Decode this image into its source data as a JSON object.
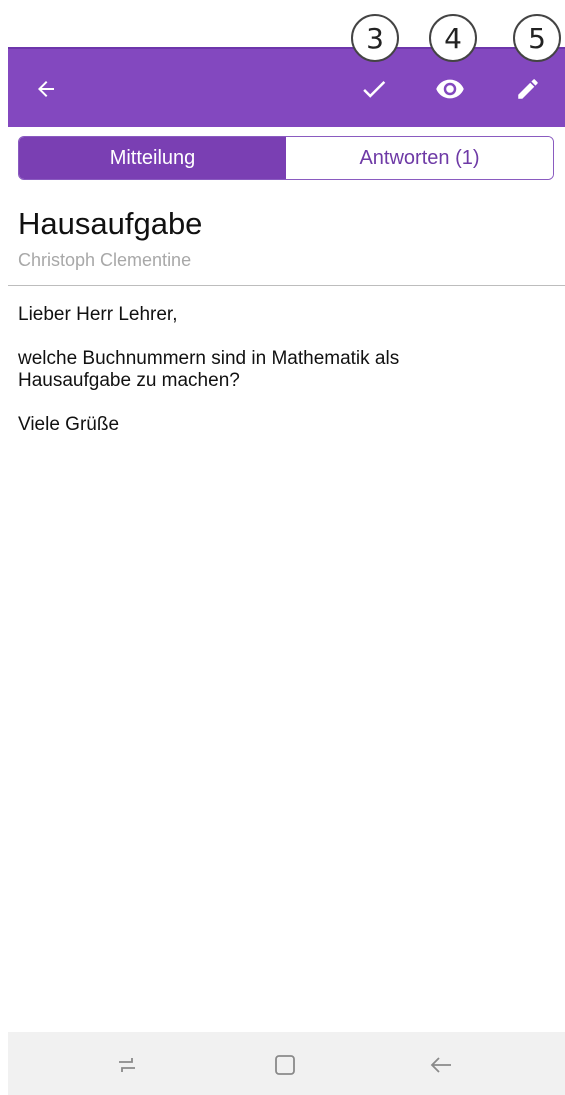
{
  "appbar": {
    "back_icon": "arrow-left-icon",
    "actions": [
      {
        "icon": "check-icon",
        "callout": "3"
      },
      {
        "icon": "eye-icon",
        "callout": "4"
      },
      {
        "icon": "pencil-icon",
        "callout": "5"
      }
    ],
    "background": "#8348bf"
  },
  "tabs": [
    {
      "label": "Mitteilung",
      "active": true
    },
    {
      "label": "Antworten (1)",
      "active": false
    }
  ],
  "message": {
    "title": "Hausaufgabe",
    "author": "Christoph Clementine",
    "paragraphs": [
      "Lieber Herr Lehrer,",
      "welche Buchnummern sind in Mathematik als\nHausaufgabe zu machen?",
      "Viele Grüße"
    ]
  },
  "navbar": {
    "icons": [
      "recents-icon",
      "home-icon",
      "back-icon"
    ]
  }
}
